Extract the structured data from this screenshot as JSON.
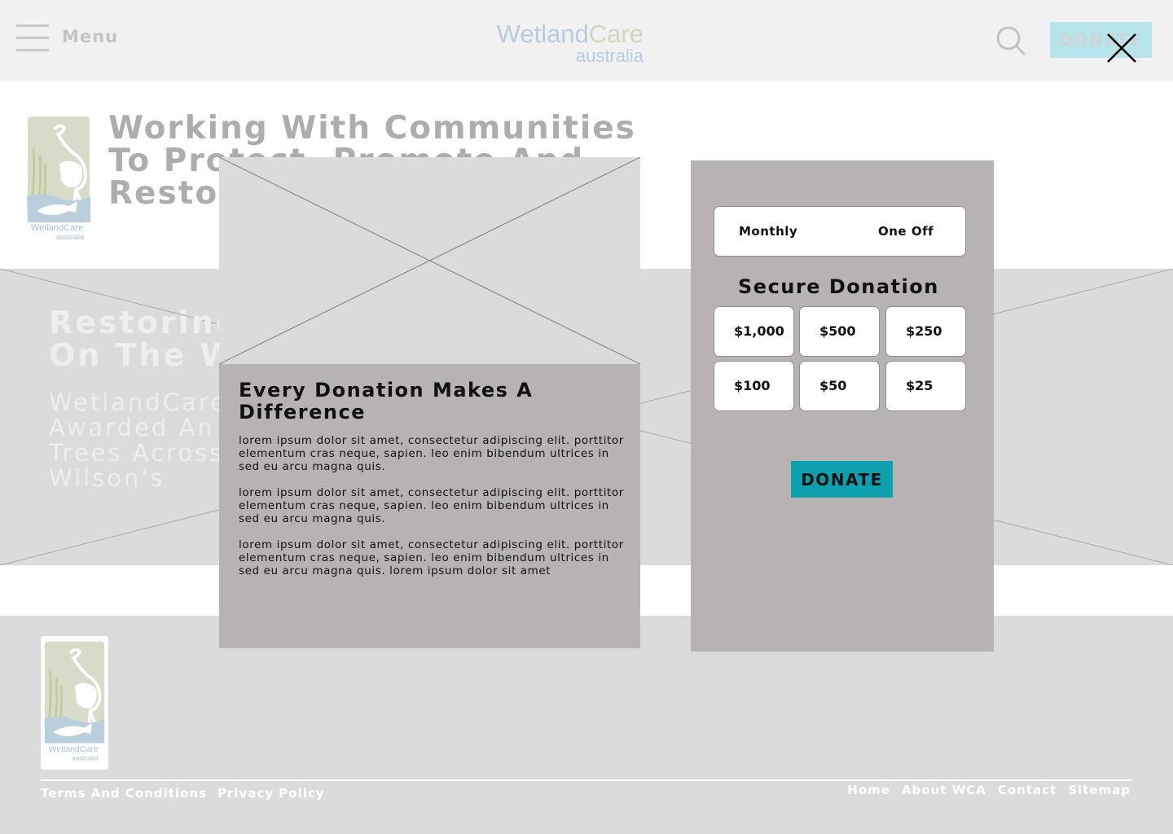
{
  "header": {
    "menu_label": "Menu",
    "brand_word1": "Wetland",
    "brand_word2": "Care",
    "brand_sub": "australia",
    "donate_label": "DONATE",
    "icons": [
      "hamburger-icon",
      "search-icon",
      "close-icon"
    ]
  },
  "hero": {
    "title": "Working With Communities To Protect, Promote And Restore Wetlands",
    "logo_text1": "WetlandCare",
    "logo_text2": "australia"
  },
  "band": {
    "heading": "Restoring Habitat On The Wilson's",
    "text": "WetlandCare Australia Awarded An Extra Million Trees Across Hectares Of The Wilson's"
  },
  "info_card": {
    "title": "Every Donation Makes A Difference",
    "paragraphs": [
      "lorem ipsum dolor sit amet, consectetur adipiscing elit. porttitor elementum cras neque, sapien. leo enim bibendum ultrices in sed eu arcu magna quis.",
      "lorem ipsum dolor sit amet, consectetur adipiscing elit. porttitor elementum cras neque, sapien. leo enim bibendum ultrices in sed eu arcu magna quis.",
      "lorem ipsum dolor sit amet, consectetur adipiscing elit. porttitor elementum cras neque, sapien. leo enim bibendum ultrices in sed eu arcu magna quis. lorem ipsum dolor sit amet"
    ]
  },
  "donation": {
    "frequency": [
      "Monthly",
      "One Off"
    ],
    "title": "Secure Donation",
    "amounts": [
      "$1,000",
      "$500",
      "$250",
      "$100",
      "$50",
      "$25"
    ],
    "donate_label": "DONATE",
    "accent_color": "#0ea0ae"
  },
  "footer": {
    "left_links": [
      "Terms And Conditions",
      "Privacy Policy"
    ],
    "right_links": [
      "Home",
      "About WCA",
      "Contact",
      "Sitemap"
    ],
    "logo_text1": "WetlandCare",
    "logo_text2": "australia"
  }
}
